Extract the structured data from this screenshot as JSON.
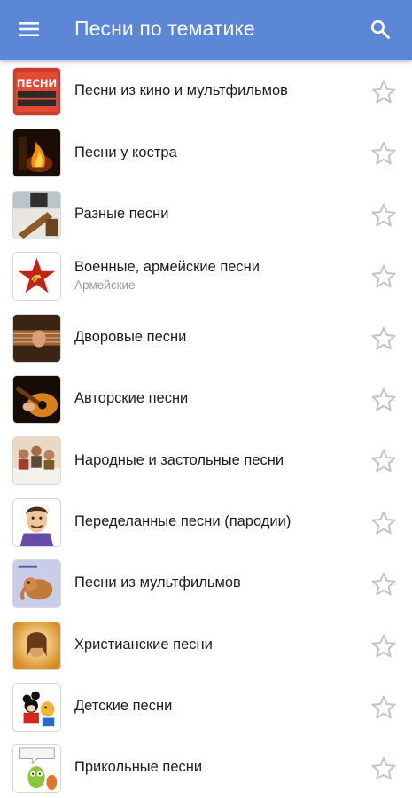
{
  "header": {
    "title": "Песни по тематике",
    "background_color": "#5b87d6",
    "menu_icon": "menu-icon",
    "search_icon": "search-icon"
  },
  "colors": {
    "star_outline": "#c4c4c4",
    "sublabel": "#9a9a9a"
  },
  "items": [
    {
      "label": "Песни из кино и мультфильмов",
      "sublabel": "",
      "thumb_text": "ПЕСНИ"
    },
    {
      "label": "Песни у костра",
      "sublabel": ""
    },
    {
      "label": "Разные песни",
      "sublabel": ""
    },
    {
      "label": "Военные, армейские песни",
      "sublabel": "Армейские"
    },
    {
      "label": "Дворовые песни",
      "sublabel": ""
    },
    {
      "label": "Авторские песни",
      "sublabel": ""
    },
    {
      "label": "Народные и застольные песни",
      "sublabel": ""
    },
    {
      "label": "Переделанные песни (пародии)",
      "sublabel": ""
    },
    {
      "label": "Песни из мультфильмов",
      "sublabel": ""
    },
    {
      "label": "Христианские песни",
      "sublabel": ""
    },
    {
      "label": "Детские песни",
      "sublabel": ""
    },
    {
      "label": "Прикольные песни",
      "sublabel": ""
    }
  ]
}
